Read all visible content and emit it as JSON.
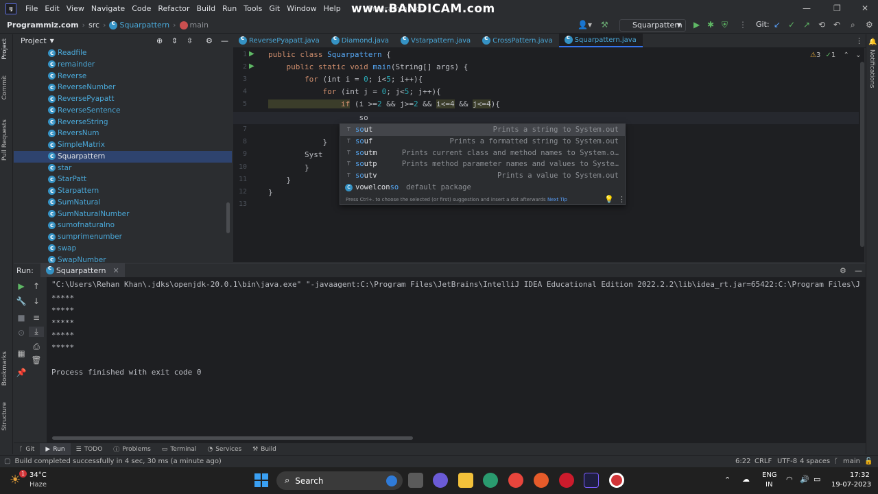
{
  "menu": {
    "items": [
      "File",
      "Edit",
      "View",
      "Navigate",
      "Code",
      "Refactor",
      "Build",
      "Run",
      "Tools",
      "Git",
      "Window",
      "Help"
    ],
    "project_title": "Programmiz.co"
  },
  "watermark": "www.BANDICAM.com",
  "breadcrumb": {
    "project": "Programmiz.com",
    "src": "src",
    "class": "Squarpattern",
    "method": "main"
  },
  "run_config": "Squarpattern",
  "git_label": "Git:",
  "project_panel": {
    "title": "Project",
    "items": [
      "Readfile",
      "remainder",
      "Reverse",
      "ReverseNumber",
      "ReversePyapatt",
      "ReverseSentence",
      "ReverseString",
      "ReversNum",
      "SimpleMatrix",
      "Squarpattern",
      "star",
      "StarPatt",
      "Starpattern",
      "SumNatural",
      "SumNaturalNumber",
      "sumofnaturalno",
      "sumprimenumber",
      "swap",
      "SwapNumber"
    ],
    "selected_index": 9
  },
  "left_strip": {
    "project": "Project",
    "commit": "Commit",
    "pull_requests": "Pull Requests",
    "bookmarks": "Bookmarks",
    "structure": "Structure"
  },
  "right_strip": {
    "notifications": "Notifications"
  },
  "editor_tabs": [
    "ReversePyapatt.java",
    "Diamond.java",
    "Vstarpattern.java",
    "CrossPattern.java",
    "Squarpattern.java"
  ],
  "active_tab": 4,
  "inspections": {
    "warnings": "3",
    "weak": "1"
  },
  "line_numbers": [
    "1",
    "2",
    "3",
    "4",
    "5",
    "6",
    "7",
    "8",
    "9",
    "10",
    "11",
    "12",
    "13"
  ],
  "code": {
    "l1a": "public class ",
    "l1b": "Squarpattern",
    "l1c": " {",
    "l2a": "    public static void ",
    "l2b": "main",
    "l2c": "(String[] args) {",
    "l3a": "        for ",
    "l3b": "(int ",
    "l3c": "i = ",
    "l3d": "0",
    "l3e": "; i<",
    "l3f": "5",
    "l3g": "; i++){",
    "l4a": "            for ",
    "l4b": "(int ",
    "l4c": "j = ",
    "l4d": "0",
    "l4e": "; j<",
    "l4f": "5",
    "l4g": "; j++){",
    "l5a": "                if",
    "l5b": " (i >=",
    "l5c": "2",
    "l5d": " && j>=",
    "l5e": "2",
    "l5f": " && ",
    "l5g": "i<=4",
    "l5h": " && ",
    "l5i": "j<=4",
    "l5j": "){",
    "l6": "                    so",
    "l7": "                }",
    "l8": "            }",
    "l9": "        Syst",
    "l10": "        }",
    "l11": "    }",
    "l12": "}"
  },
  "completion": {
    "items": [
      {
        "prefix": "so",
        "rest": "ut",
        "desc": "Prints a string to System.out"
      },
      {
        "prefix": "so",
        "rest": "uf",
        "desc": "Prints a formatted string to System.out"
      },
      {
        "prefix": "so",
        "rest": "utm",
        "desc": "Prints current class and method names to System.o…"
      },
      {
        "prefix": "so",
        "rest": "utp",
        "desc": "Prints method parameter names and values to Syste…"
      },
      {
        "prefix": "so",
        "rest": "utv",
        "desc": "Prints a value to System.out"
      },
      {
        "prefix": "vowelcon",
        "rest": "so",
        "desc": "default package"
      }
    ],
    "footer": "Press Ctrl+. to choose the selected (or first) suggestion and insert a dot afterwards",
    "next_tip": "Next Tip"
  },
  "run_panel": {
    "label": "Run:",
    "tab": "Squarpattern",
    "command": "\"C:\\Users\\Rehan Khan\\.jdks\\openjdk-20.0.1\\bin\\java.exe\" \"-javaagent:C:\\Program Files\\JetBrains\\IntelliJ IDEA Educational Edition 2022.2.2\\lib\\idea_rt.jar=65422:C:\\Program Files\\J",
    "output": [
      "*****",
      "*****",
      "*****",
      "*****",
      "*****"
    ],
    "finished": "Process finished with exit code 0"
  },
  "bottom_tabs": [
    "Git",
    "Run",
    "TODO",
    "Problems",
    "Terminal",
    "Services",
    "Build"
  ],
  "status": {
    "message": "Build completed successfully in 4 sec, 30 ms (a minute ago)",
    "position": "6:22",
    "line_sep": "CRLF",
    "encoding": "UTF-8",
    "indent": "4 spaces",
    "branch": "main"
  },
  "taskbar": {
    "weather_temp": "34°C",
    "weather_desc": "Haze",
    "weather_badge": "1",
    "search": "Search",
    "lang1": "ENG",
    "lang2": "IN",
    "time": "17:32",
    "date": "19-07-2023"
  }
}
